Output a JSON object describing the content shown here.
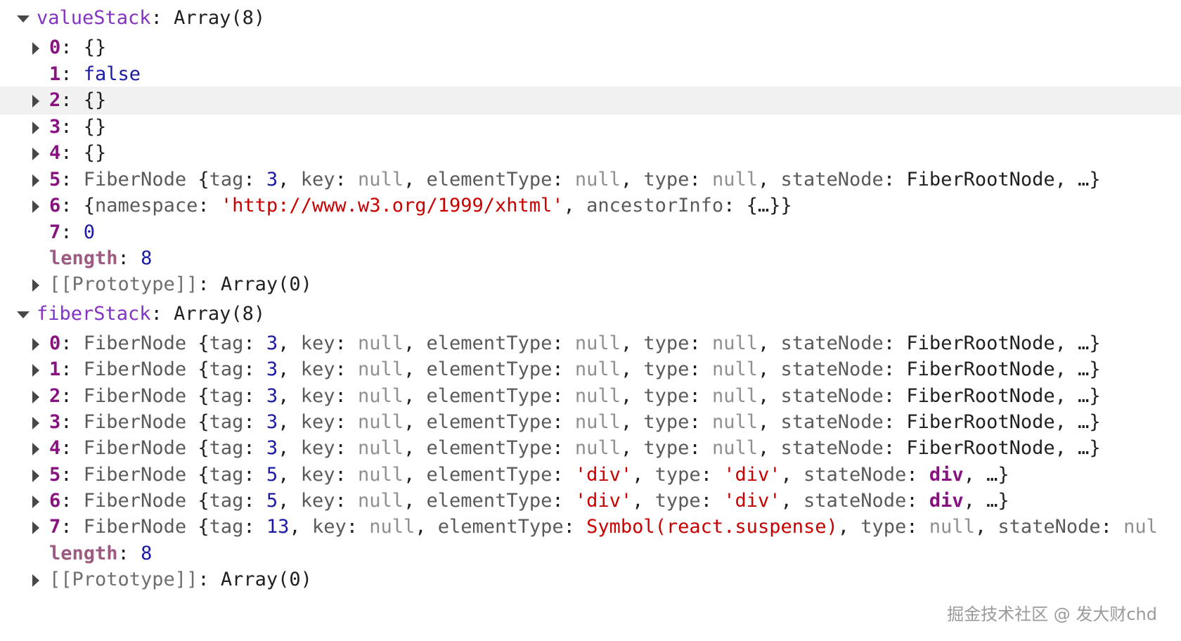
{
  "console": {
    "rows": [
      {
        "depth": 0,
        "toggle": "down",
        "parts": [
          [
            "rootkey",
            "valueStack"
          ],
          [
            "plain",
            ": Array(8)"
          ]
        ]
      },
      {
        "depth": 1,
        "toggle": "right",
        "parts": [
          [
            "key",
            "0"
          ],
          [
            "plain",
            ": {}"
          ]
        ]
      },
      {
        "depth": 1,
        "toggle": "none",
        "parts": [
          [
            "key",
            "1"
          ],
          [
            "plain",
            ": "
          ],
          [
            "bool",
            "false"
          ]
        ]
      },
      {
        "depth": 1,
        "toggle": "right",
        "highlight": true,
        "parts": [
          [
            "key",
            "2"
          ],
          [
            "plain",
            ": {}"
          ]
        ]
      },
      {
        "depth": 1,
        "toggle": "right",
        "parts": [
          [
            "key",
            "3"
          ],
          [
            "plain",
            ": {}"
          ]
        ]
      },
      {
        "depth": 1,
        "toggle": "right",
        "parts": [
          [
            "key",
            "4"
          ],
          [
            "plain",
            ": {}"
          ]
        ]
      },
      {
        "depth": 1,
        "toggle": "right",
        "parts": [
          [
            "key",
            "5"
          ],
          [
            "plain",
            ": "
          ],
          [
            "ctor",
            "FiberNode "
          ],
          [
            "plain",
            "{"
          ],
          [
            "prop",
            "tag"
          ],
          [
            "plain",
            ": "
          ],
          [
            "num",
            "3"
          ],
          [
            "plain",
            ", "
          ],
          [
            "prop",
            "key"
          ],
          [
            "plain",
            ": "
          ],
          [
            "nul",
            "null"
          ],
          [
            "plain",
            ", "
          ],
          [
            "prop",
            "elementType"
          ],
          [
            "plain",
            ": "
          ],
          [
            "nul",
            "null"
          ],
          [
            "plain",
            ", "
          ],
          [
            "prop",
            "type"
          ],
          [
            "plain",
            ": "
          ],
          [
            "nul",
            "null"
          ],
          [
            "plain",
            ", "
          ],
          [
            "prop",
            "stateNode"
          ],
          [
            "plain",
            ": FiberRootNode, …}"
          ]
        ]
      },
      {
        "depth": 1,
        "toggle": "right",
        "parts": [
          [
            "key",
            "6"
          ],
          [
            "plain",
            ": {"
          ],
          [
            "prop",
            "namespace"
          ],
          [
            "plain",
            ": "
          ],
          [
            "str",
            "'http://www.w3.org/1999/xhtml'"
          ],
          [
            "plain",
            ", "
          ],
          [
            "prop",
            "ancestorInfo"
          ],
          [
            "plain",
            ": {…}}"
          ]
        ]
      },
      {
        "depth": 1,
        "toggle": "none",
        "parts": [
          [
            "key",
            "7"
          ],
          [
            "plain",
            ": "
          ],
          [
            "num",
            "0"
          ]
        ]
      },
      {
        "depth": 1,
        "toggle": "none",
        "parts": [
          [
            "dimkey",
            "length"
          ],
          [
            "plain",
            ": "
          ],
          [
            "num",
            "8"
          ]
        ]
      },
      {
        "depth": 1,
        "toggle": "right",
        "parts": [
          [
            "proto",
            "[[Prototype]]"
          ],
          [
            "plain",
            ": Array(0)"
          ]
        ]
      },
      {
        "depth": 0,
        "toggle": "down",
        "parts": [
          [
            "rootkey",
            "fiberStack"
          ],
          [
            "plain",
            ": Array(8)"
          ]
        ]
      },
      {
        "depth": 1,
        "toggle": "right",
        "parts": [
          [
            "key",
            "0"
          ],
          [
            "plain",
            ": "
          ],
          [
            "ctor",
            "FiberNode "
          ],
          [
            "plain",
            "{"
          ],
          [
            "prop",
            "tag"
          ],
          [
            "plain",
            ": "
          ],
          [
            "num",
            "3"
          ],
          [
            "plain",
            ", "
          ],
          [
            "prop",
            "key"
          ],
          [
            "plain",
            ": "
          ],
          [
            "nul",
            "null"
          ],
          [
            "plain",
            ", "
          ],
          [
            "prop",
            "elementType"
          ],
          [
            "plain",
            ": "
          ],
          [
            "nul",
            "null"
          ],
          [
            "plain",
            ", "
          ],
          [
            "prop",
            "type"
          ],
          [
            "plain",
            ": "
          ],
          [
            "nul",
            "null"
          ],
          [
            "plain",
            ", "
          ],
          [
            "prop",
            "stateNode"
          ],
          [
            "plain",
            ": FiberRootNode, …}"
          ]
        ]
      },
      {
        "depth": 1,
        "toggle": "right",
        "parts": [
          [
            "key",
            "1"
          ],
          [
            "plain",
            ": "
          ],
          [
            "ctor",
            "FiberNode "
          ],
          [
            "plain",
            "{"
          ],
          [
            "prop",
            "tag"
          ],
          [
            "plain",
            ": "
          ],
          [
            "num",
            "3"
          ],
          [
            "plain",
            ", "
          ],
          [
            "prop",
            "key"
          ],
          [
            "plain",
            ": "
          ],
          [
            "nul",
            "null"
          ],
          [
            "plain",
            ", "
          ],
          [
            "prop",
            "elementType"
          ],
          [
            "plain",
            ": "
          ],
          [
            "nul",
            "null"
          ],
          [
            "plain",
            ", "
          ],
          [
            "prop",
            "type"
          ],
          [
            "plain",
            ": "
          ],
          [
            "nul",
            "null"
          ],
          [
            "plain",
            ", "
          ],
          [
            "prop",
            "stateNode"
          ],
          [
            "plain",
            ": FiberRootNode, …}"
          ]
        ]
      },
      {
        "depth": 1,
        "toggle": "right",
        "parts": [
          [
            "key",
            "2"
          ],
          [
            "plain",
            ": "
          ],
          [
            "ctor",
            "FiberNode "
          ],
          [
            "plain",
            "{"
          ],
          [
            "prop",
            "tag"
          ],
          [
            "plain",
            ": "
          ],
          [
            "num",
            "3"
          ],
          [
            "plain",
            ", "
          ],
          [
            "prop",
            "key"
          ],
          [
            "plain",
            ": "
          ],
          [
            "nul",
            "null"
          ],
          [
            "plain",
            ", "
          ],
          [
            "prop",
            "elementType"
          ],
          [
            "plain",
            ": "
          ],
          [
            "nul",
            "null"
          ],
          [
            "plain",
            ", "
          ],
          [
            "prop",
            "type"
          ],
          [
            "plain",
            ": "
          ],
          [
            "nul",
            "null"
          ],
          [
            "plain",
            ", "
          ],
          [
            "prop",
            "stateNode"
          ],
          [
            "plain",
            ": FiberRootNode, …}"
          ]
        ]
      },
      {
        "depth": 1,
        "toggle": "right",
        "parts": [
          [
            "key",
            "3"
          ],
          [
            "plain",
            ": "
          ],
          [
            "ctor",
            "FiberNode "
          ],
          [
            "plain",
            "{"
          ],
          [
            "prop",
            "tag"
          ],
          [
            "plain",
            ": "
          ],
          [
            "num",
            "3"
          ],
          [
            "plain",
            ", "
          ],
          [
            "prop",
            "key"
          ],
          [
            "plain",
            ": "
          ],
          [
            "nul",
            "null"
          ],
          [
            "plain",
            ", "
          ],
          [
            "prop",
            "elementType"
          ],
          [
            "plain",
            ": "
          ],
          [
            "nul",
            "null"
          ],
          [
            "plain",
            ", "
          ],
          [
            "prop",
            "type"
          ],
          [
            "plain",
            ": "
          ],
          [
            "nul",
            "null"
          ],
          [
            "plain",
            ", "
          ],
          [
            "prop",
            "stateNode"
          ],
          [
            "plain",
            ": FiberRootNode, …}"
          ]
        ]
      },
      {
        "depth": 1,
        "toggle": "right",
        "parts": [
          [
            "key",
            "4"
          ],
          [
            "plain",
            ": "
          ],
          [
            "ctor",
            "FiberNode "
          ],
          [
            "plain",
            "{"
          ],
          [
            "prop",
            "tag"
          ],
          [
            "plain",
            ": "
          ],
          [
            "num",
            "3"
          ],
          [
            "plain",
            ", "
          ],
          [
            "prop",
            "key"
          ],
          [
            "plain",
            ": "
          ],
          [
            "nul",
            "null"
          ],
          [
            "plain",
            ", "
          ],
          [
            "prop",
            "elementType"
          ],
          [
            "plain",
            ": "
          ],
          [
            "nul",
            "null"
          ],
          [
            "plain",
            ", "
          ],
          [
            "prop",
            "type"
          ],
          [
            "plain",
            ": "
          ],
          [
            "nul",
            "null"
          ],
          [
            "plain",
            ", "
          ],
          [
            "prop",
            "stateNode"
          ],
          [
            "plain",
            ": FiberRootNode, …}"
          ]
        ]
      },
      {
        "depth": 1,
        "toggle": "right",
        "parts": [
          [
            "key",
            "5"
          ],
          [
            "plain",
            ": "
          ],
          [
            "ctor",
            "FiberNode "
          ],
          [
            "plain",
            "{"
          ],
          [
            "prop",
            "tag"
          ],
          [
            "plain",
            ": "
          ],
          [
            "num",
            "5"
          ],
          [
            "plain",
            ", "
          ],
          [
            "prop",
            "key"
          ],
          [
            "plain",
            ": "
          ],
          [
            "nul",
            "null"
          ],
          [
            "plain",
            ", "
          ],
          [
            "prop",
            "elementType"
          ],
          [
            "plain",
            ": "
          ],
          [
            "str",
            "'div'"
          ],
          [
            "plain",
            ", "
          ],
          [
            "prop",
            "type"
          ],
          [
            "plain",
            ": "
          ],
          [
            "str",
            "'div'"
          ],
          [
            "plain",
            ", "
          ],
          [
            "prop",
            "stateNode"
          ],
          [
            "plain",
            ": "
          ],
          [
            "key",
            "div"
          ],
          [
            "plain",
            ", …}"
          ]
        ]
      },
      {
        "depth": 1,
        "toggle": "right",
        "parts": [
          [
            "key",
            "6"
          ],
          [
            "plain",
            ": "
          ],
          [
            "ctor",
            "FiberNode "
          ],
          [
            "plain",
            "{"
          ],
          [
            "prop",
            "tag"
          ],
          [
            "plain",
            ": "
          ],
          [
            "num",
            "5"
          ],
          [
            "plain",
            ", "
          ],
          [
            "prop",
            "key"
          ],
          [
            "plain",
            ": "
          ],
          [
            "nul",
            "null"
          ],
          [
            "plain",
            ", "
          ],
          [
            "prop",
            "elementType"
          ],
          [
            "plain",
            ": "
          ],
          [
            "str",
            "'div'"
          ],
          [
            "plain",
            ", "
          ],
          [
            "prop",
            "type"
          ],
          [
            "plain",
            ": "
          ],
          [
            "str",
            "'div'"
          ],
          [
            "plain",
            ", "
          ],
          [
            "prop",
            "stateNode"
          ],
          [
            "plain",
            ": "
          ],
          [
            "key",
            "div"
          ],
          [
            "plain",
            ", …}"
          ]
        ]
      },
      {
        "depth": 1,
        "toggle": "right",
        "parts": [
          [
            "key",
            "7"
          ],
          [
            "plain",
            ": "
          ],
          [
            "ctor",
            "FiberNode "
          ],
          [
            "plain",
            "{"
          ],
          [
            "prop",
            "tag"
          ],
          [
            "plain",
            ": "
          ],
          [
            "num",
            "13"
          ],
          [
            "plain",
            ", "
          ],
          [
            "prop",
            "key"
          ],
          [
            "plain",
            ": "
          ],
          [
            "nul",
            "null"
          ],
          [
            "plain",
            ", "
          ],
          [
            "prop",
            "elementType"
          ],
          [
            "plain",
            ": "
          ],
          [
            "str",
            "Symbol(react.suspense)"
          ],
          [
            "plain",
            ", "
          ],
          [
            "prop",
            "type"
          ],
          [
            "plain",
            ": "
          ],
          [
            "nul",
            "null"
          ],
          [
            "plain",
            ", "
          ],
          [
            "prop",
            "stateNode"
          ],
          [
            "plain",
            ": "
          ],
          [
            "nul",
            "nul"
          ]
        ]
      },
      {
        "depth": 1,
        "toggle": "none",
        "parts": [
          [
            "dimkey",
            "length"
          ],
          [
            "plain",
            ": "
          ],
          [
            "num",
            "8"
          ]
        ]
      },
      {
        "depth": 1,
        "toggle": "right",
        "parts": [
          [
            "proto",
            "[[Prototype]]"
          ],
          [
            "plain",
            ": Array(0)"
          ]
        ]
      }
    ]
  },
  "watermark": "掘金技术社区 @ 发大财chd",
  "colors": {
    "key": "#881280",
    "root_key": "#8431c5",
    "string": "#c80000",
    "number": "#1a1aa6",
    "null": "#8f8f8f",
    "highlight_row": "#f1f1f1"
  },
  "icons": {
    "collapsed": "triangle-right-icon",
    "expanded": "triangle-down-icon"
  }
}
